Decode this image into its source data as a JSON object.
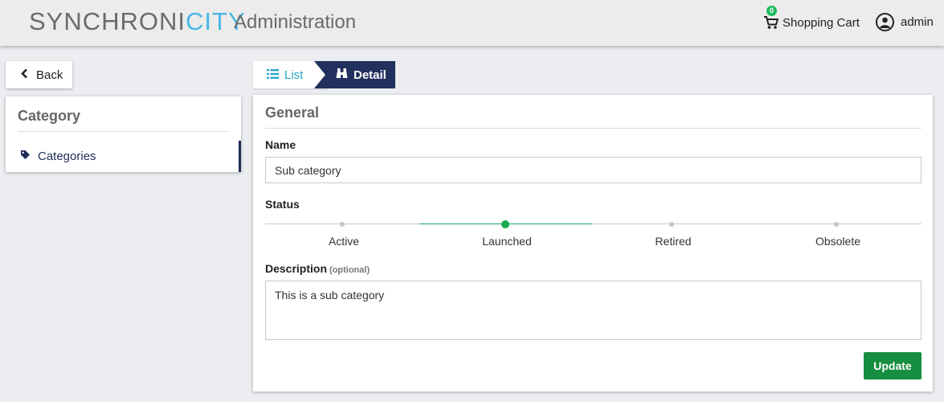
{
  "header": {
    "logo_part1": "SYNCHRONI",
    "logo_part2": "CITY",
    "title": "Administration",
    "cart_count": "0",
    "cart_label": "Shopping Cart",
    "user_label": "admin"
  },
  "sidebar": {
    "back_label": "Back",
    "title": "Category",
    "items": [
      {
        "label": "Categories",
        "icon": "tag-icon",
        "active": true
      }
    ]
  },
  "tabs": [
    {
      "label": "List",
      "icon": "list-icon",
      "active": false
    },
    {
      "label": "Detail",
      "icon": "binoculars-icon",
      "active": true
    }
  ],
  "form": {
    "section_title": "General",
    "name_label": "Name",
    "name_value": "Sub category",
    "status_label": "Status",
    "status_steps": [
      "Active",
      "Launched",
      "Retired",
      "Obsolete"
    ],
    "status_selected": "Launched",
    "description_label": "Description",
    "description_optional": "(optional)",
    "description_value": "This is a sub category",
    "submit_label": "Update"
  },
  "colors": {
    "header_bg": "#ececec",
    "logo_accent": "#4ab6e6",
    "nav_dark": "#22305d",
    "tab_link": "#27a7c7",
    "status_green": "#1aab4c",
    "button_green": "#168e3f",
    "badge_green": "#1ebc5c"
  }
}
